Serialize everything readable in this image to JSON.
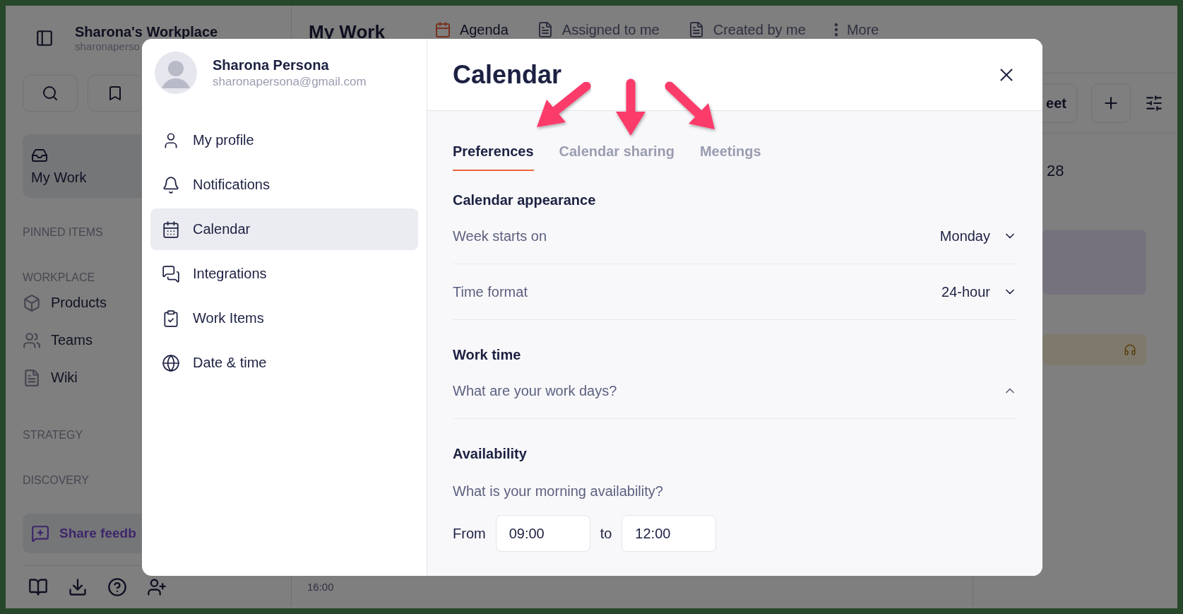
{
  "app": {
    "workspace": {
      "name": "Sharona's Workplace",
      "subtitle": "sharonaperso"
    },
    "sidebar": {
      "home_card": "My Work",
      "sections": [
        {
          "label": "PINNED ITEMS"
        },
        {
          "label": "WORKPLACE",
          "items": [
            "Products",
            "Teams",
            "Wiki"
          ]
        },
        {
          "label": "STRATEGY"
        },
        {
          "label": "DISCOVERY"
        }
      ],
      "feedback": "Share feedb"
    },
    "main": {
      "title": "My Work",
      "tabs": [
        {
          "label": "Agenda",
          "selected": true
        },
        {
          "label": "Assigned to me",
          "selected": false
        },
        {
          "label": "Created by me",
          "selected": false
        },
        {
          "label": "More",
          "selected": false
        }
      ],
      "toolbar": {
        "meet_button": "eet"
      },
      "date": "28",
      "time_label": "16:00"
    }
  },
  "settings": {
    "user": {
      "name": "Sharona Persona",
      "email": "sharonapersona@gmail.com"
    },
    "nav": [
      {
        "label": "My profile",
        "selected": false
      },
      {
        "label": "Notifications",
        "selected": false
      },
      {
        "label": "Calendar",
        "selected": true
      },
      {
        "label": "Integrations",
        "selected": false
      },
      {
        "label": "Work Items",
        "selected": false
      },
      {
        "label": "Date & time",
        "selected": false
      }
    ],
    "panel": {
      "title": "Calendar",
      "tabs": [
        {
          "label": "Preferences",
          "selected": true
        },
        {
          "label": "Calendar sharing",
          "selected": false
        },
        {
          "label": "Meetings",
          "selected": false
        }
      ],
      "sections": [
        {
          "heading": "Calendar appearance",
          "rows": [
            {
              "kind": "select",
              "label": "Week starts on",
              "value": "Monday"
            },
            {
              "kind": "select",
              "label": "Time format",
              "value": "24-hour"
            }
          ]
        },
        {
          "heading": "Work time",
          "rows": [
            {
              "kind": "accordion",
              "label": "What are your work days?",
              "expanded": true
            }
          ]
        },
        {
          "heading": "Availability",
          "rows": [
            {
              "kind": "range",
              "label": "What is your morning availability?",
              "from_label": "From",
              "from": "09:00",
              "to_label": "to",
              "to": "12:00"
            }
          ]
        }
      ]
    }
  }
}
